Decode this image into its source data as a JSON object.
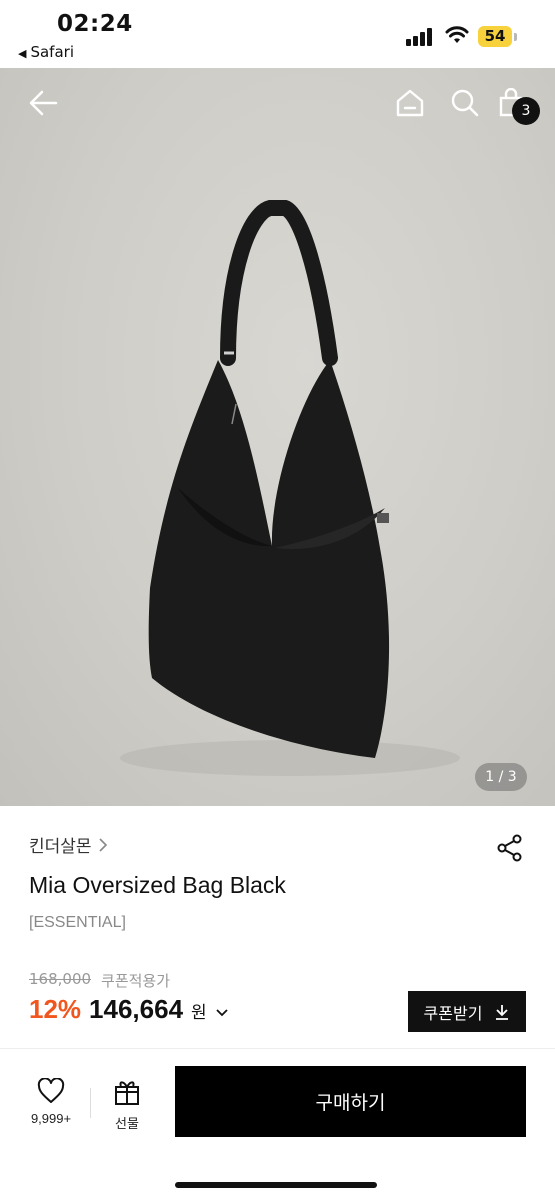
{
  "status_bar": {
    "time": "02:24",
    "back_app": "Safari",
    "battery": "54"
  },
  "nav": {
    "cart_count": "3"
  },
  "gallery": {
    "counter": "1 / 3"
  },
  "product": {
    "brand": "킨더살몬",
    "name": "Mia Oversized Bag Black",
    "tag": "[ESSENTIAL]",
    "original_price": "168,000",
    "coupon_applied_label": "쿠폰적용가",
    "discount": "12%",
    "sale_price": "146,664",
    "currency": "원",
    "coupon_button": "쿠폰받기"
  },
  "bottom_bar": {
    "like_count": "9,999+",
    "gift_label": "선물",
    "buy_label": "구매하기"
  },
  "colors": {
    "accent": "#f0561e",
    "primary": "#000000",
    "battery": "#f7d23c"
  }
}
